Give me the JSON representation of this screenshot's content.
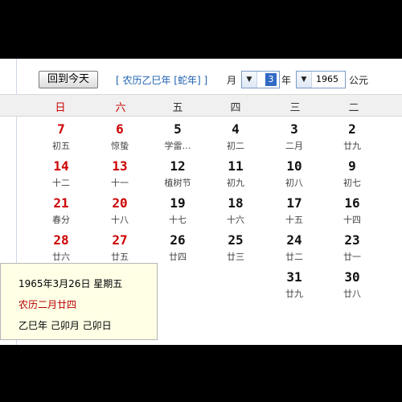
{
  "toolbar": {
    "today_button": "回到今天",
    "lunar_title": "[ 农历乙巳年 [蛇年] ]",
    "month_label": "月",
    "month_value": "3",
    "year_label": "年",
    "year_value": "1965",
    "era_label": "公元"
  },
  "weekdays": [
    "日",
    "六",
    "五",
    "四",
    "三",
    "二"
  ],
  "rows": [
    [
      {
        "day": "7",
        "lunar": "初五"
      },
      {
        "day": "6",
        "lunar": "惊蛰"
      },
      {
        "day": "5",
        "lunar": "学雷…"
      },
      {
        "day": "4",
        "lunar": "初二"
      },
      {
        "day": "3",
        "lunar": "二月"
      },
      {
        "day": "2",
        "lunar": "廿九"
      }
    ],
    [
      {
        "day": "14",
        "lunar": "十二"
      },
      {
        "day": "13",
        "lunar": "十一"
      },
      {
        "day": "12",
        "lunar": "植树节"
      },
      {
        "day": "11",
        "lunar": "初九"
      },
      {
        "day": "10",
        "lunar": "初八"
      },
      {
        "day": "9",
        "lunar": "初七"
      }
    ],
    [
      {
        "day": "21",
        "lunar": "春分"
      },
      {
        "day": "20",
        "lunar": "十八"
      },
      {
        "day": "19",
        "lunar": "十七"
      },
      {
        "day": "18",
        "lunar": "十六"
      },
      {
        "day": "17",
        "lunar": "十五"
      },
      {
        "day": "16",
        "lunar": "十四"
      }
    ],
    [
      {
        "day": "28",
        "lunar": "廿六"
      },
      {
        "day": "27",
        "lunar": "廿五"
      },
      {
        "day": "26",
        "lunar": "廿四"
      },
      {
        "day": "25",
        "lunar": "廿三"
      },
      {
        "day": "24",
        "lunar": "廿二"
      },
      {
        "day": "23",
        "lunar": "廿一"
      }
    ],
    [
      {
        "day": "",
        "lunar": ""
      },
      {
        "day": "",
        "lunar": ""
      },
      {
        "day": "",
        "lunar": ""
      },
      {
        "day": "",
        "lunar": ""
      },
      {
        "day": "31",
        "lunar": "廿九"
      },
      {
        "day": "30",
        "lunar": "廿八"
      }
    ]
  ],
  "tooltip": {
    "line1": "1965年3月26日 星期五",
    "line2": "农历二月廿四",
    "line3": "乙巳年 己卯月 己卯日"
  },
  "colors": {
    "weekend": "#cc0000",
    "accent": "#316ac5",
    "tooltip_bg": "#ffffe6"
  }
}
